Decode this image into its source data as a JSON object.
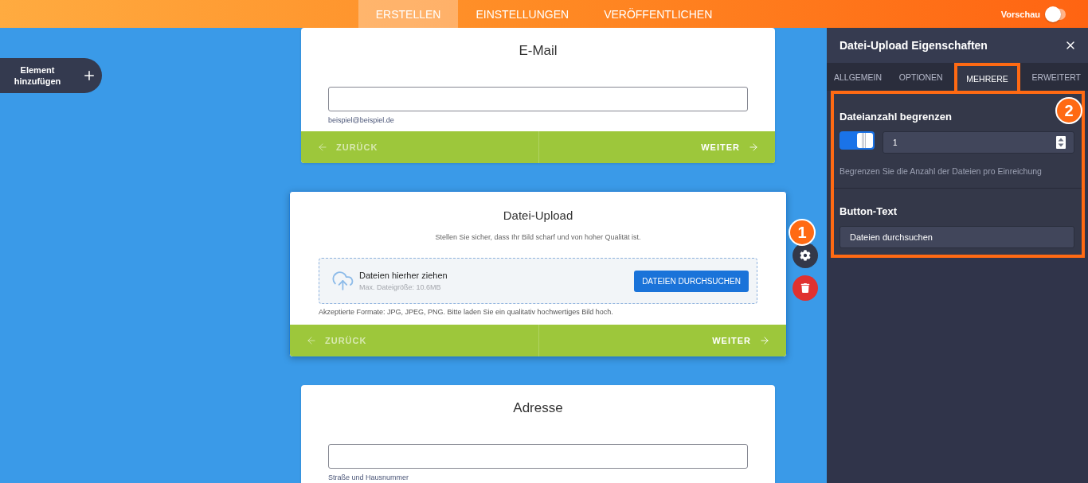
{
  "top_bar": {
    "tabs": [
      {
        "label": "ERSTELLEN",
        "selected": true
      },
      {
        "label": "EINSTELLUNGEN",
        "selected": false
      },
      {
        "label": "VERÖFFENTLICHEN",
        "selected": false
      }
    ],
    "preview": {
      "label": "Vorschau",
      "on": false
    }
  },
  "add_element_button": {
    "label": "Element hinzufügen"
  },
  "form_cards": [
    {
      "kind": "text_field",
      "title": "E-Mail",
      "sublabel": "beispiel@beispiel.de",
      "selected": false,
      "navigation": {
        "back": "ZURÜCK",
        "next": "WEITER"
      }
    },
    {
      "kind": "file_upload",
      "title": "Datei-Upload",
      "description": "Stellen Sie sicher, dass Ihr Bild scharf und von hoher Qualität ist.",
      "dropzone": {
        "title": "Dateien hierher ziehen",
        "size_limit": "Max. Dateigröße: 10.6MB",
        "button": "DATEIEN DURCHSUCHEN"
      },
      "note": "Akzeptierte Formate: JPG, JPEG, PNG. Bitte laden Sie ein qualitativ hochwertiges Bild hoch.",
      "selected": true,
      "navigation": {
        "back": "ZURÜCK",
        "next": "WEITER"
      },
      "toolbar": {
        "step_badge": "1"
      }
    },
    {
      "kind": "text_field",
      "title": "Adresse",
      "sublabel": "Straße und Hausnummer",
      "selected": false
    }
  ],
  "properties_panel": {
    "title": "Datei-Upload Eigenschaften",
    "tabs": [
      {
        "label": "ALLGEMEIN",
        "selected": false,
        "highlighted": false
      },
      {
        "label": "OPTIONEN",
        "selected": false,
        "highlighted": false
      },
      {
        "label": "MEHRERE",
        "selected": true,
        "highlighted": true
      },
      {
        "label": "ERWEITERT",
        "selected": false,
        "highlighted": false
      }
    ],
    "section": {
      "highlighted": true,
      "step_badge": "2",
      "fields": [
        {
          "kind": "toggle_number",
          "label": "Dateianzahl begrenzen",
          "on": true,
          "value": "1",
          "hint": "Begrenzen Sie die Anzahl der Dateien pro Einreichung"
        },
        {
          "kind": "text",
          "label": "Button-Text",
          "value": "Dateien durchsuchen"
        }
      ]
    }
  }
}
